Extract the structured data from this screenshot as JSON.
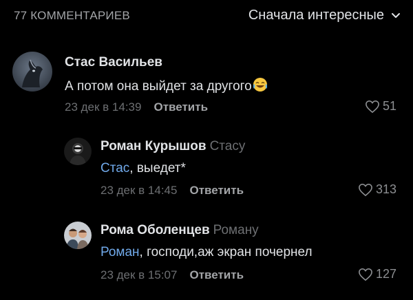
{
  "header": {
    "count_label": "77 КОММЕНТАРИЕВ",
    "sort_label": "Сначала интересные",
    "sort_icon": "chevron-down-icon"
  },
  "comments": [
    {
      "author": "Стас Васильев",
      "text": "А потом она выйдет за другого",
      "emoji": "face-with-tears-of-joy",
      "date": "23 дек в 14:39",
      "reply_label": "Ответить",
      "likes": "51"
    },
    {
      "author": "Роман Курышов",
      "reply_to": "Стасу",
      "mention": "Стас",
      "text": ", выедет*",
      "date": "23 дек в 14:45",
      "reply_label": "Ответить",
      "likes": "313"
    },
    {
      "author": "Рома Оболенцев",
      "reply_to": "Роману",
      "mention": "Роман",
      "text": ", господи,аж экран почернел",
      "date": "23 дек в 15:07",
      "reply_label": "Ответить",
      "likes": "127"
    }
  ],
  "colors": {
    "background": "#000000",
    "text_primary": "#e1e3e6",
    "text_secondary": "#6d6f72",
    "mention": "#71aaeb"
  }
}
